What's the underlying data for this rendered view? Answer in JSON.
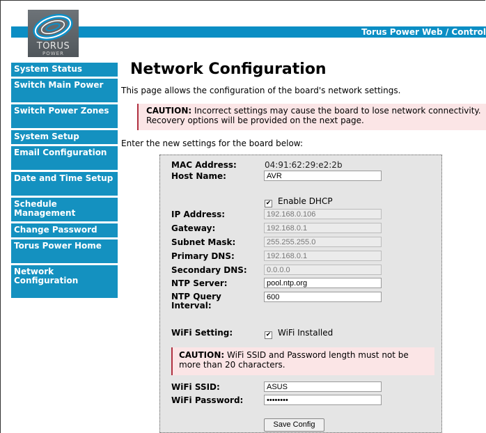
{
  "header": {
    "banner_title": "Torus Power Web / Control",
    "logo_text": "TORUS",
    "logo_subtext": "POWER"
  },
  "sidebar": {
    "items": [
      {
        "label": "System Status"
      },
      {
        "label": "Switch Main Power"
      },
      {
        "label": "Switch Power Zones"
      },
      {
        "label": "System Setup"
      },
      {
        "label": "Email Configuration"
      },
      {
        "label": "Date and Time Setup"
      },
      {
        "label": "Schedule Management"
      },
      {
        "label": "Change Password"
      },
      {
        "label": "Torus Power Home"
      },
      {
        "label": "Network Configuration"
      }
    ]
  },
  "main": {
    "title": "Network Configuration",
    "intro": "This page allows the configuration of the board's network settings.",
    "caution1_strong": "CAUTION:",
    "caution1_text": " Incorrect settings may cause the board to lose network connectivity. Recovery options will be provided on the next page.",
    "enter_text": "Enter the new settings for the board below:"
  },
  "form": {
    "mac_label": "MAC Address:",
    "mac_value": "04:91:62:29:e2:2b",
    "host_label": "Host Name:",
    "host_value": "AVR",
    "dhcp_label": "Enable DHCP",
    "dhcp_checked": "✔",
    "ip_label": "IP Address:",
    "ip_value": "192.168.0.106",
    "gateway_label": "Gateway:",
    "gateway_value": "192.168.0.1",
    "subnet_label": "Subnet Mask:",
    "subnet_value": "255.255.255.0",
    "pdns_label": "Primary DNS:",
    "pdns_value": "192.168.0.1",
    "sdns_label": "Secondary DNS:",
    "sdns_value": "0.0.0.0",
    "ntp_label": "NTP Server:",
    "ntp_value": "pool.ntp.org",
    "ntp_interval_label": "NTP Query Interval:",
    "ntp_interval_value": "600",
    "wifi_setting_label": "WiFi Setting:",
    "wifi_installed_label": "WiFi Installed",
    "wifi_installed_checked": "✔",
    "caution2_strong": "CAUTION:",
    "caution2_text": " WiFi SSID and Password length must not be more than 20 characters.",
    "ssid_label": "WiFi SSID:",
    "ssid_value": "ASUS",
    "password_label": "WiFi Password:",
    "password_value": "••••••••",
    "save_label": "Save Config"
  },
  "colors": {
    "accent": "#1491c0",
    "caution_bg": "#fbe5e6",
    "caution_border": "#b03040",
    "form_bg": "#e5e5e5"
  }
}
